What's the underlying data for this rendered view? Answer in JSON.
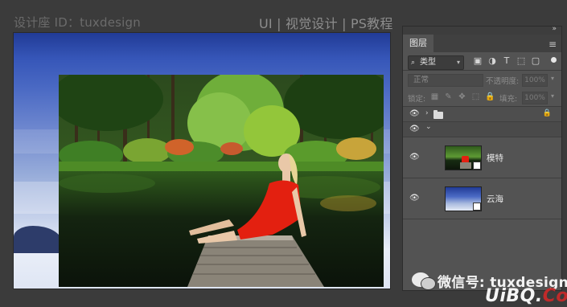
{
  "watermark": {
    "left": "设计座 ID：tuxdesign",
    "right": "UI | 视觉设计 | PS教程"
  },
  "layers_panel": {
    "tab_label": "图层",
    "collapse_icon": "double-chevron",
    "menu_icon": "hamburger",
    "filter": {
      "search_glyph": "⌕",
      "kind_label": "类型",
      "dropdown_glyph": "▾",
      "icons": [
        "image-filter-icon",
        "adjustment-filter-icon",
        "type-filter-icon",
        "shape-filter-icon",
        "smart-object-filter-icon"
      ],
      "icon_glyphs": [
        "▣",
        "◑",
        "T",
        "⬚",
        "▢"
      ]
    },
    "blend_mode": "正常",
    "opacity_label": "不透明度:",
    "opacity_value": "100%",
    "lock_label": "锁定:",
    "lock_glyphs": [
      "▦",
      "✎",
      "✥",
      "⬚",
      "🔒"
    ],
    "fill_label": "填充:",
    "fill_value": "100%",
    "layers": [
      {
        "type": "group",
        "name": "",
        "expanded": false,
        "locked": true,
        "visible": true
      },
      {
        "type": "group",
        "name": "",
        "expanded": true,
        "locked": false,
        "visible": true
      },
      {
        "type": "smart-object",
        "name": "模特",
        "visible": true
      },
      {
        "type": "smart-object",
        "name": "云海",
        "visible": true
      }
    ],
    "glyphs": {
      "eye": "👁",
      "caret_collapsed": "›",
      "caret_expanded": "⌄",
      "lock": "🔒"
    }
  },
  "footer": {
    "wechat": "微信号: tuxdesign",
    "site_main": "UiBQ.",
    "site_accent": "CoM"
  },
  "colors": {
    "panel_bg": "#535353",
    "app_bg": "#3b3b3b",
    "accent_red": "#bf2a2a"
  }
}
